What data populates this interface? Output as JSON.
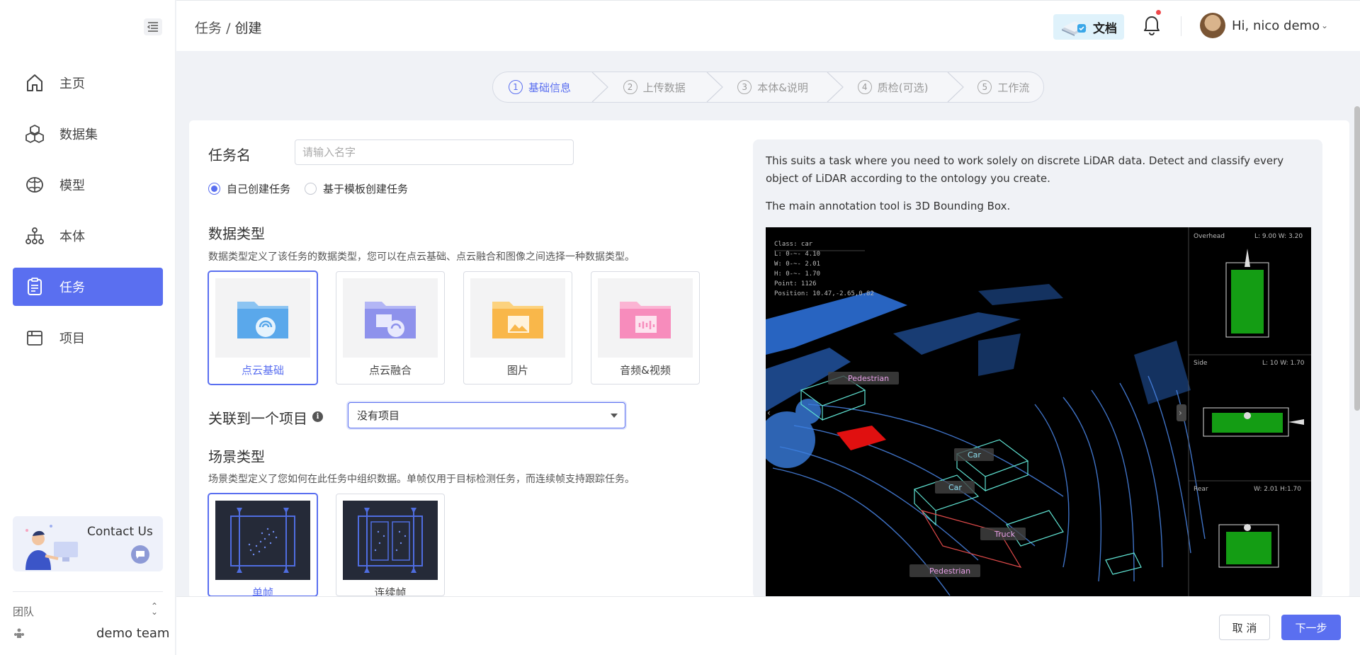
{
  "sidebar": {
    "items": [
      {
        "label": "主页",
        "icon": "home-icon"
      },
      {
        "label": "数据集",
        "icon": "dataset-icon"
      },
      {
        "label": "模型",
        "icon": "model-icon"
      },
      {
        "label": "本体",
        "icon": "ontology-icon"
      },
      {
        "label": "任务",
        "icon": "task-icon",
        "active": true
      },
      {
        "label": "项目",
        "icon": "project-icon"
      }
    ],
    "contact_us": "Contact Us",
    "team_label": "团队",
    "team_name": "demo team"
  },
  "header": {
    "breadcrumb_parent": "任务",
    "breadcrumb_sep": "/",
    "breadcrumb_current": "创建",
    "docs_label": "文档",
    "user_greeting": "Hi,",
    "user_name": "nico demo"
  },
  "stepper": {
    "steps": [
      {
        "num": "1",
        "label": "基础信息",
        "active": true
      },
      {
        "num": "2",
        "label": "上传数据"
      },
      {
        "num": "3",
        "label": "本体&说明"
      },
      {
        "num": "4",
        "label": "质检(可选)"
      },
      {
        "num": "5",
        "label": "工作流"
      }
    ]
  },
  "form": {
    "task_name_label": "任务名",
    "task_name_placeholder": "请输入名字",
    "task_name_value": "",
    "radio_self": "自己创建任务",
    "radio_template": "基于模板创建任务",
    "data_type_title": "数据类型",
    "data_type_desc": "数据类型定义了该任务的数据类型，您可以在点云基础、点云融合和图像之间选择一种数据类型。",
    "data_types": [
      "点云基础",
      "点云融合",
      "图片",
      "音频&视频"
    ],
    "project_label": "关联到一个项目",
    "project_value": "没有项目",
    "scene_title": "场景类型",
    "scene_desc": "场景类型定义了您如何在此任务中组织数据。单帧仅用于目标检测任务，而连续帧支持跟踪任务。",
    "scene_types": [
      "单帧",
      "连续帧"
    ]
  },
  "preview": {
    "text1": "This suits a task where you need to work solely on discrete LiDAR data. Detect and classify every object of LiDAR according to the ontology you create.",
    "text2": "The main annotation tool is 3D Bounding Box.",
    "info_lines": [
      "Class:  car",
      "L:  0-~- 4.10",
      "W:  0-~- 2.01",
      "H:  0-~- 1.70",
      "Point:  1126",
      "Position:  10.47,-2.65,0.82"
    ],
    "labels": [
      "Pedestrian",
      "Car",
      "Car",
      "Truck",
      "Pedestrian"
    ],
    "views": [
      {
        "name": "Overhead",
        "dims": "L: 9.00 W: 3.20"
      },
      {
        "name": "Side",
        "dims": "L: 10 W: 1.70"
      },
      {
        "name": "Rear",
        "dims": "W: 2.01 H:1.70"
      }
    ]
  },
  "footer": {
    "cancel": "取 消",
    "next": "下一步"
  },
  "colors": {
    "accent": "#5a6ff0"
  }
}
